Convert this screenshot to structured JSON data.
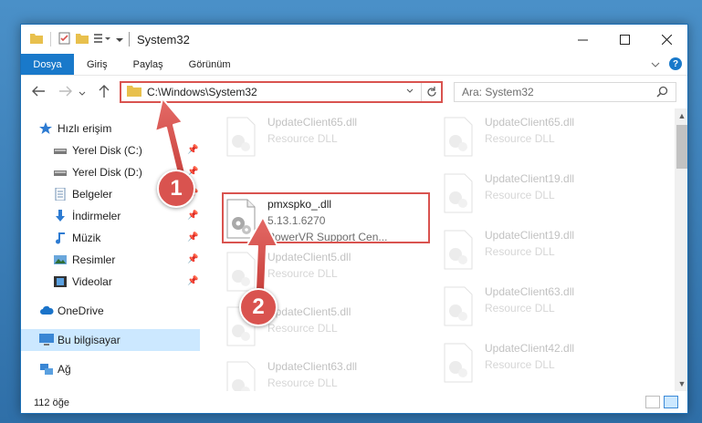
{
  "window": {
    "title": "System32"
  },
  "ribbon": {
    "tabs": [
      "Dosya",
      "Giriş",
      "Paylaş",
      "Görünüm"
    ]
  },
  "address": {
    "path": "C:\\Windows\\System32",
    "search_placeholder": "Ara: System32"
  },
  "navpane": {
    "items": [
      {
        "label": "Hızlı erişim",
        "icon": "star-icon",
        "pinned": false
      },
      {
        "label": "Yerel Disk (C:)",
        "icon": "drive-icon",
        "pinned": true
      },
      {
        "label": "Yerel Disk (D:)",
        "icon": "drive-icon",
        "pinned": true
      },
      {
        "label": "Belgeler",
        "icon": "documents-icon",
        "pinned": true
      },
      {
        "label": "İndirmeler",
        "icon": "download-icon",
        "pinned": true
      },
      {
        "label": "Müzik",
        "icon": "music-icon",
        "pinned": true
      },
      {
        "label": "Resimler",
        "icon": "pictures-icon",
        "pinned": true
      },
      {
        "label": "Videolar",
        "icon": "videos-icon",
        "pinned": true
      },
      {
        "label": "OneDrive",
        "icon": "cloud-icon",
        "pinned": false
      },
      {
        "label": "Bu bilgisayar",
        "icon": "computer-icon",
        "pinned": false,
        "selected": true
      },
      {
        "label": "Ağ",
        "icon": "network-icon",
        "pinned": false
      }
    ]
  },
  "files": {
    "highlighted": {
      "name": "pmxspko_.dll",
      "version": "5.13.1.6270",
      "description": "PowerVR Support Cen..."
    },
    "left_column": [
      {
        "name": "UpdateClient65.dll",
        "type": "Resource DLL"
      },
      {
        "name": "UpdateClient5.dll",
        "type": "Resource DLL"
      },
      {
        "name": "UpdateClient5.dll",
        "type": "Resource DLL"
      },
      {
        "name": "UpdateClient63.dll",
        "type": "Resource DLL"
      }
    ],
    "right_column": [
      {
        "name": "UpdateClient65.dll",
        "type": "Resource DLL"
      },
      {
        "name": "UpdateClient19.dll",
        "type": "Resource DLL"
      },
      {
        "name": "UpdateClient19.dll",
        "type": "Resource DLL"
      },
      {
        "name": "UpdateClient63.dll",
        "type": "Resource DLL"
      },
      {
        "name": "UpdateClient42.dll",
        "type": "Resource DLL"
      }
    ]
  },
  "status": {
    "item_count": "112 öğe"
  },
  "annotations": {
    "step1": "1",
    "step2": "2",
    "color": "#d9534f"
  },
  "colors": {
    "accent": "#1979ca",
    "selection": "#cce8ff",
    "highlight": "#d9534f"
  }
}
